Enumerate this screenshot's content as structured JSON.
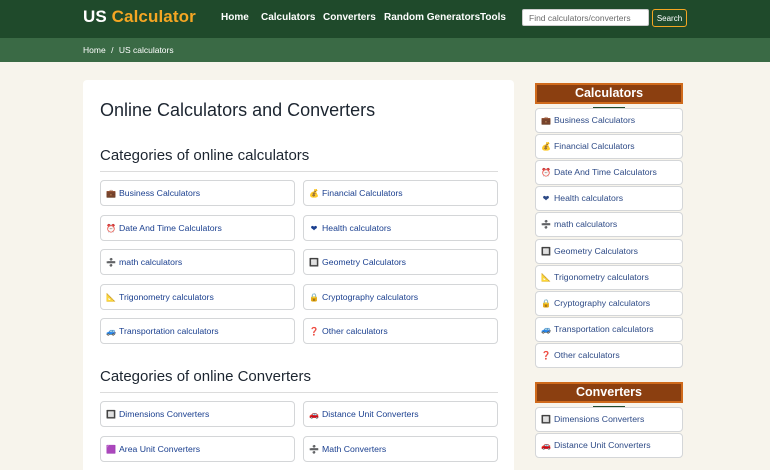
{
  "header": {
    "brand_us": "US",
    "brand_calc": "Calculator",
    "nav": [
      "Home",
      "Calculators",
      "Converters",
      "Random Generators",
      "Tools"
    ],
    "search_placeholder": "Find calculators/converters",
    "search_button": "Search"
  },
  "breadcrumb": {
    "home": "Home",
    "separator": "/",
    "current": "US calculators"
  },
  "main": {
    "title": "Online Calculators and Converters",
    "calculators_heading": "Categories of online calculators",
    "converters_heading": "Categories of online Converters",
    "calculator_categories": [
      {
        "icon": "briefcase-icon",
        "glyph": "💼",
        "label": "Business Calculators"
      },
      {
        "icon": "money-bag-icon",
        "glyph": "💰",
        "label": "Financial Calculators"
      },
      {
        "icon": "alarm-clock-icon",
        "glyph": "⏰",
        "label": "Date And Time Calculators"
      },
      {
        "icon": "heart-icon",
        "glyph": "❤",
        "label": "Health calculators"
      },
      {
        "icon": "math-plus-divide-icon",
        "glyph": "➗",
        "label": "math calculators"
      },
      {
        "icon": "geometry-icon",
        "glyph": "🔲",
        "label": "Geometry Calculators"
      },
      {
        "icon": "triangle-ruler-icon",
        "glyph": "📐",
        "label": "Trigonometry calculators"
      },
      {
        "icon": "lock-icon",
        "glyph": "🔒",
        "label": "Cryptography calculators"
      },
      {
        "icon": "car-icon",
        "glyph": "🚙",
        "label": "Transportation calculators"
      },
      {
        "icon": "question-mark-icon",
        "glyph": "❓",
        "label": "Other calculators"
      }
    ],
    "converter_categories": [
      {
        "icon": "dimensions-icon",
        "glyph": "🔲",
        "label": "Dimensions Converters"
      },
      {
        "icon": "car-icon",
        "glyph": "🚗",
        "label": "Distance Unit Converters"
      },
      {
        "icon": "purple-square-icon",
        "glyph": "🟪",
        "label": "Area Unit Converters"
      },
      {
        "icon": "math-plus-divide-icon",
        "glyph": "➗",
        "label": "Math Converters"
      }
    ]
  },
  "sidebar": {
    "calculators_title": "Calculators",
    "converters_title": "Converters",
    "calculators": [
      {
        "icon": "briefcase-icon",
        "glyph": "💼",
        "label": "Business Calculators"
      },
      {
        "icon": "money-bag-icon",
        "glyph": "💰",
        "label": "Financial Calculators"
      },
      {
        "icon": "alarm-clock-icon",
        "glyph": "⏰",
        "label": "Date And Time Calculators"
      },
      {
        "icon": "heart-icon",
        "glyph": "❤",
        "label": "Health calculators"
      },
      {
        "icon": "math-plus-divide-icon",
        "glyph": "➗",
        "label": "math calculators"
      },
      {
        "icon": "geometry-icon",
        "glyph": "🔲",
        "label": "Geometry Calculators"
      },
      {
        "icon": "triangle-ruler-icon",
        "glyph": "📐",
        "label": "Trigonometry calculators"
      },
      {
        "icon": "lock-icon",
        "glyph": "🔒",
        "label": "Cryptography calculators"
      },
      {
        "icon": "car-icon",
        "glyph": "🚙",
        "label": "Transportation calculators"
      },
      {
        "icon": "question-mark-icon",
        "glyph": "❓",
        "label": "Other calculators"
      }
    ],
    "converters": [
      {
        "icon": "dimensions-icon",
        "glyph": "🔲",
        "label": "Dimensions Converters"
      },
      {
        "icon": "car-icon",
        "glyph": "🚗",
        "label": "Distance Unit Converters"
      }
    ]
  },
  "colors": {
    "header_bg": "#1f4a2b",
    "breadcrumb_bg": "#3a6a45",
    "brand_accent": "#f5a623",
    "sidebar_head_bg": "#8b3f10",
    "link": "#1a3f8f"
  }
}
